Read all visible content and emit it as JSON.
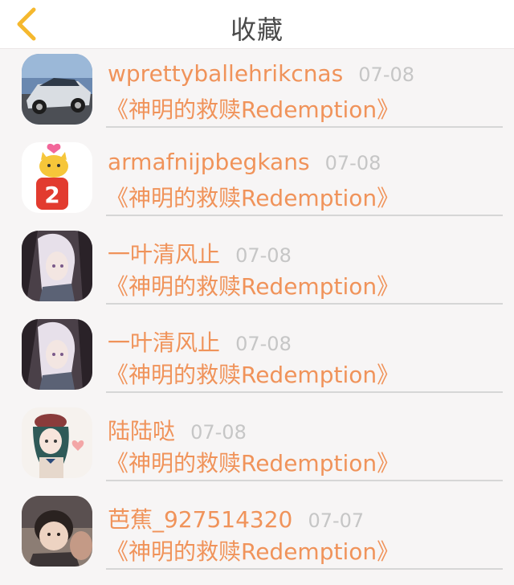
{
  "header": {
    "title": "收藏",
    "back_icon": "chevron-left-icon",
    "accent_color": "#f5b82e"
  },
  "items": [
    {
      "name": "wprettyballehrikcnas",
      "time": "07-08",
      "book": "《神明的救赎Redemption》",
      "avatar": "car-photo"
    },
    {
      "name": "armafnijpbegkans",
      "time": "07-08",
      "book": "《神明的救赎Redemption》",
      "avatar": "cat-badge-2",
      "badge": "2"
    },
    {
      "name": "一叶清风止",
      "time": "07-08",
      "book": "《神明的救赎Redemption》",
      "avatar": "anime-character"
    },
    {
      "name": "一叶清风止",
      "time": "07-08",
      "book": "《神明的救赎Redemption》",
      "avatar": "anime-character"
    },
    {
      "name": "陆陆哒",
      "time": "07-08",
      "book": "《神明的救赎Redemption》",
      "avatar": "anime-girl-beret"
    },
    {
      "name": "芭蕉_927514320",
      "time": "07-07",
      "book": "《神明的救赎Redemption》",
      "avatar": "child-photo"
    }
  ],
  "colors": {
    "name": "#f0935a",
    "time": "#c6c6c6",
    "title": "#4a4a4a",
    "background": "#f7f5f5"
  }
}
